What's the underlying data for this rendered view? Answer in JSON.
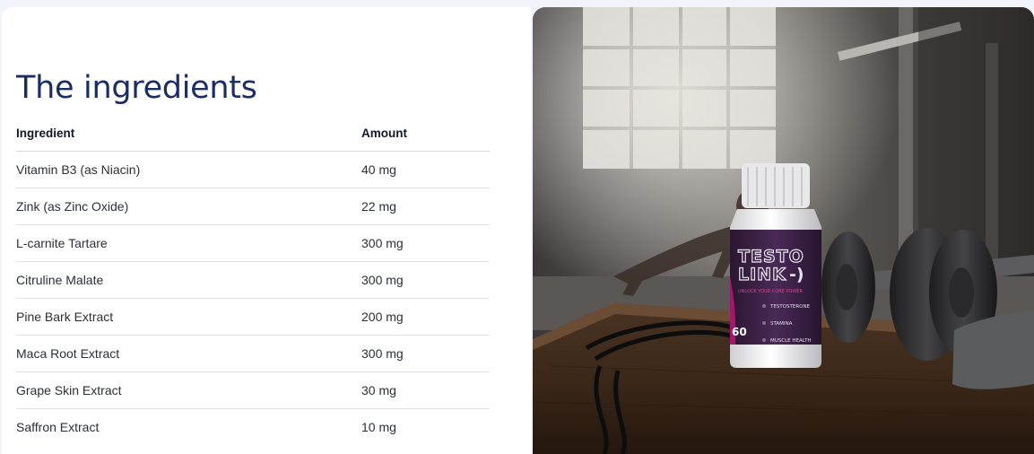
{
  "section": {
    "title": "The ingredients"
  },
  "table": {
    "headers": [
      "Ingredient",
      "Amount"
    ],
    "rows": [
      {
        "ingredient": "Vitamin B3 (as Niacin)",
        "amount": "40 mg"
      },
      {
        "ingredient": "Zink (as Zinc Oxide)",
        "amount": "22 mg"
      },
      {
        "ingredient": "L-carnite Tartare",
        "amount": "300 mg"
      },
      {
        "ingredient": "Citruline Malate",
        "amount": "300 mg"
      },
      {
        "ingredient": "Pine Bark Extract",
        "amount": "200 mg"
      },
      {
        "ingredient": "Maca Root Extract",
        "amount": "300 mg"
      },
      {
        "ingredient": "Grape Skin Extract",
        "amount": "30 mg"
      },
      {
        "ingredient": "Saffron Extract",
        "amount": "10 mg"
      }
    ]
  },
  "product": {
    "brand_line1": "TESTO",
    "brand_line2": "LINK",
    "tagline": "UNLOCK YOUR CORE POWER",
    "count": "60",
    "benefits": [
      "TESTOSTERONE",
      "STAMINA",
      "MUSCLE HEALTH"
    ]
  },
  "colors": {
    "title": "#1a2e64",
    "page_bg": "#f1f4fa",
    "label_accent": "#c2187a"
  }
}
